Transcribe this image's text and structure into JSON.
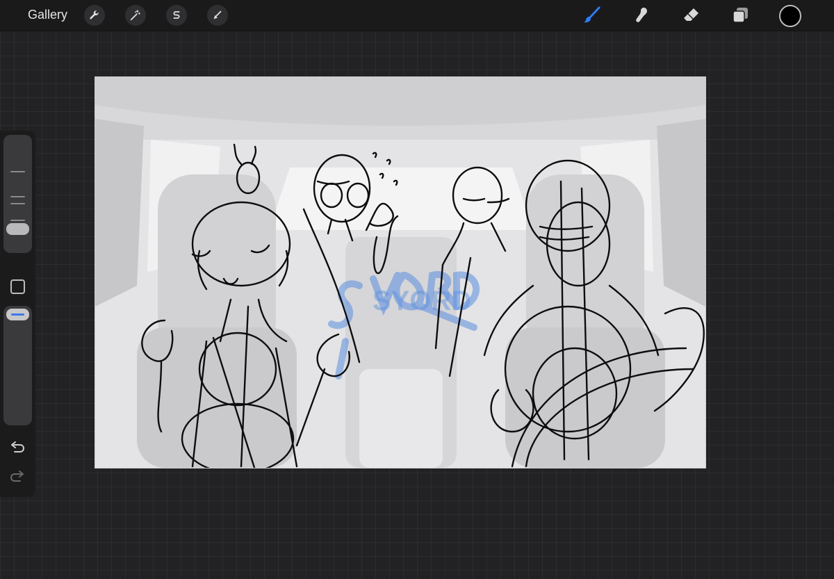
{
  "topbar": {
    "gallery_label": "Gallery",
    "left_tools": [
      "wrench-icon",
      "magic-wand-icon",
      "selection-s-icon",
      "transform-arrow-icon"
    ],
    "right_tools": [
      "brush-icon",
      "smudge-icon",
      "eraser-icon",
      "layers-icon"
    ],
    "active_tool": "brush-icon",
    "accent_color": "#2f7bf5",
    "current_color": "#000000"
  },
  "sidebar": {
    "brush_size_level": 0.15,
    "brush_opacity_level": 1.0,
    "tools": [
      "modify-button",
      "undo-icon",
      "redo-icon"
    ]
  },
  "canvas": {
    "watermark_text": "SYORD",
    "watermark_color": "#5b8fe0",
    "stroke_color": "#0d0d0d",
    "background_tone": "#e6e6e8"
  }
}
